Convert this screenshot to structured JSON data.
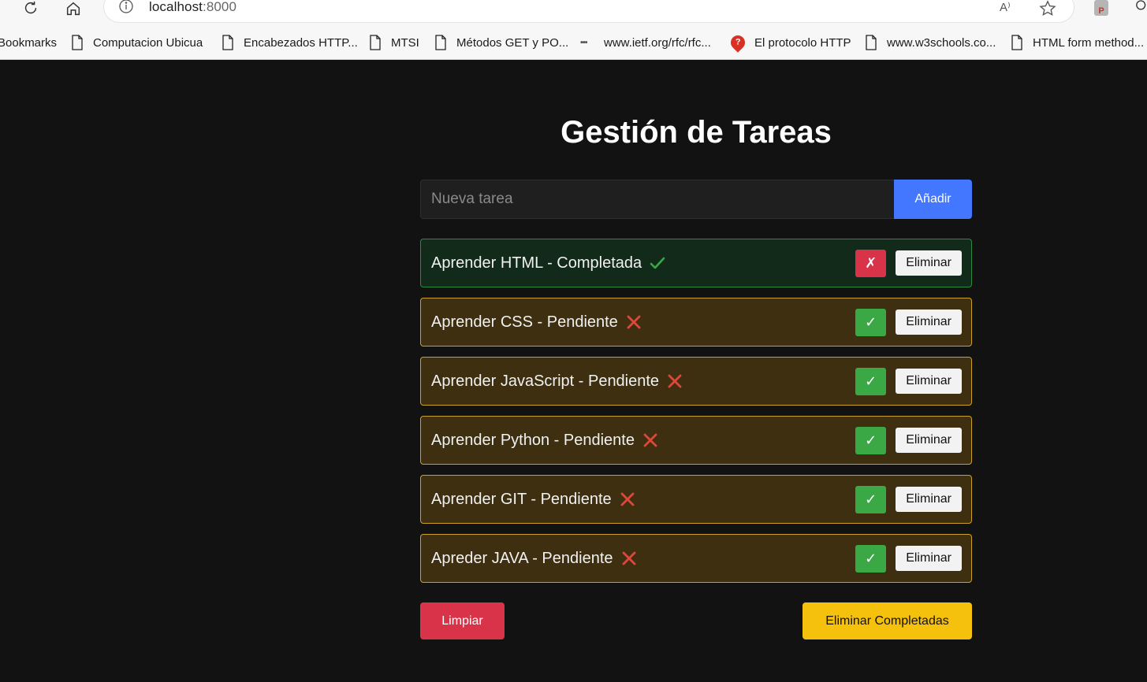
{
  "browser": {
    "url_host": "localhost",
    "url_port": ":8000",
    "read_aloud_label": "A⁾",
    "extension_label": "P",
    "bookmarks": [
      {
        "label": "Bookmarks",
        "icon": "none"
      },
      {
        "label": "Computacion Ubicua",
        "icon": "page-icon"
      },
      {
        "label": "Encabezados HTTP...",
        "icon": "page-icon"
      },
      {
        "label": "MTSI",
        "icon": "page-icon"
      },
      {
        "label": "Métodos GET y PO...",
        "icon": "page-icon"
      },
      {
        "label": "www.ietf.org/rfc/rfc...",
        "icon": "ietf-icon"
      },
      {
        "label": "El protocolo HTTP",
        "icon": "question-icon"
      },
      {
        "label": "www.w3schools.co...",
        "icon": "page-icon"
      },
      {
        "label": "HTML form method...",
        "icon": "page-icon"
      }
    ]
  },
  "app": {
    "title": "Gestión de Tareas",
    "input_placeholder": "Nueva tarea",
    "add_label": "Añadir",
    "tasks": [
      {
        "text": "Aprender HTML - Completada",
        "status": "done",
        "status_icon": "check-icon",
        "toggle_label": "✗",
        "delete_label": "Eliminar"
      },
      {
        "text": "Aprender CSS - Pendiente",
        "status": "pending",
        "status_icon": "cross-icon",
        "toggle_label": "✓",
        "delete_label": "Eliminar"
      },
      {
        "text": "Aprender JavaScript - Pendiente",
        "status": "pending",
        "status_icon": "cross-icon",
        "toggle_label": "✓",
        "delete_label": "Eliminar"
      },
      {
        "text": "Aprender Python - Pendiente",
        "status": "pending",
        "status_icon": "cross-icon",
        "toggle_label": "✓",
        "delete_label": "Eliminar"
      },
      {
        "text": "Aprender GIT - Pendiente",
        "status": "pending",
        "status_icon": "cross-icon",
        "toggle_label": "✓",
        "delete_label": "Eliminar"
      },
      {
        "text": "Apreder JAVA - Pendiente",
        "status": "pending",
        "status_icon": "cross-icon",
        "toggle_label": "✓",
        "delete_label": "Eliminar"
      }
    ],
    "clear_label": "Limpiar",
    "remove_completed_label": "Eliminar Completadas",
    "colors": {
      "background": "#121212",
      "add_button": "#4477ff",
      "done_border": "#2c8a3f",
      "pending_border": "#c9a227",
      "toggle_green": "#3aa845",
      "danger_red": "#d9334a",
      "warning_yellow": "#f5c10c"
    }
  }
}
